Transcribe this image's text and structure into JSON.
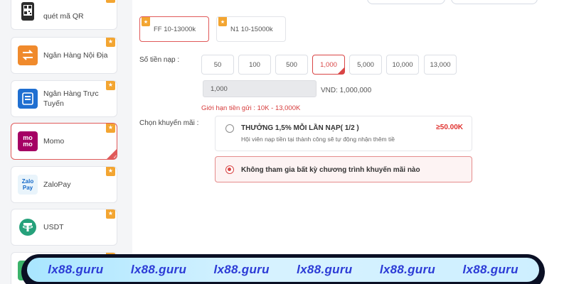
{
  "sidebar": {
    "items": [
      {
        "label": "quét mã QR",
        "icon": "qr-phone-icon",
        "active": false
      },
      {
        "label": "Ngân Hàng Nội Địa",
        "icon": "bank-transfer-icon",
        "active": false
      },
      {
        "label": "Ngân Hàng Trực Tuyến",
        "icon": "online-bank-icon",
        "active": false
      },
      {
        "label": "Momo",
        "icon": "momo-logo-icon",
        "logo_text": "mo mo",
        "active": true
      },
      {
        "label": "ZaloPay",
        "icon": "zalopay-logo-icon",
        "logo_text": "Zalo Pay",
        "active": false
      },
      {
        "label": "USDT",
        "icon": "tether-icon",
        "active": false
      }
    ]
  },
  "packages": [
    {
      "label": "FF 10-13000k",
      "active": true
    },
    {
      "label": "N1 10-15000k",
      "active": false
    }
  ],
  "deposit": {
    "label": "Số tiền nạp :",
    "amounts": [
      "50",
      "100",
      "500",
      "1,000",
      "5,000",
      "10,000",
      "13,000"
    ],
    "selected_index": 3,
    "input_value": "1,000",
    "vnd_text": "VND: 1,000,000",
    "limit_text": "Giới hạn tiền gửi :  10K  -  13,000K"
  },
  "promotion": {
    "label": "Chọn khuyến mãi :",
    "option1_title": "THƯỞNG 1,5% MỖI LẦN NẠP( 1/2 )",
    "option1_desc": "Hội viên nạp tiền tại             thành công sẽ tự động nhận thêm tiề",
    "option1_bonus": "≥50.00K",
    "option2_text": "Không tham gia bất kỳ chương trình khuyến mãi nào",
    "selected": 2
  },
  "banner": {
    "items": [
      "lx88.guru",
      "lx88.guru",
      "lx88.guru",
      "lx88.guru",
      "lx88.guru",
      "lx88.guru"
    ]
  },
  "colors": {
    "accent": "#d94545",
    "star": "#f3a531",
    "momo": "#a50064",
    "banner_text": "#2c3bd6"
  }
}
